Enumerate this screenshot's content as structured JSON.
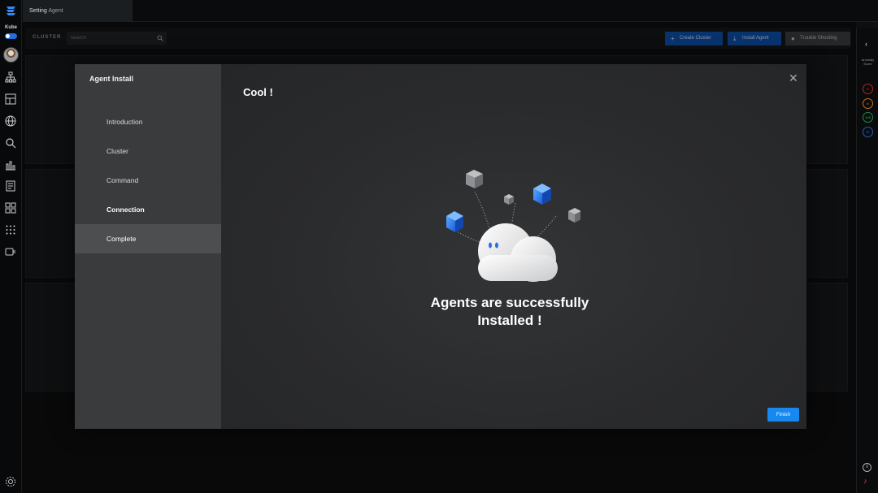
{
  "nav": {
    "kube_label": "Kube"
  },
  "topbar": {
    "tab_prefix": "Setting",
    "tab_name": "Agent"
  },
  "filterbar": {
    "cluster_label": "CLUSTER",
    "search_placeholder": "Search",
    "create_cluster": "Create Cluster",
    "install_agent": "Install Agent",
    "trouble_shooting": "Trouble Shooting"
  },
  "rightrail": {
    "anomaly_label_1": "Anomaly",
    "anomaly_label_2": "Score",
    "badges": [
      "0",
      "6",
      "145",
      "47"
    ]
  },
  "modal": {
    "title": "Agent Install",
    "steps": [
      "Introduction",
      "Cluster",
      "Command",
      "Connection",
      "Complete"
    ],
    "heading": "Cool !",
    "message_line1": "Agents are successfully",
    "message_line2": "Installed !",
    "finish_label": "Finish"
  },
  "colors": {
    "accent": "#1688f0",
    "primary_button": "#0f4fa8",
    "toggle": "#1f6fe0"
  }
}
